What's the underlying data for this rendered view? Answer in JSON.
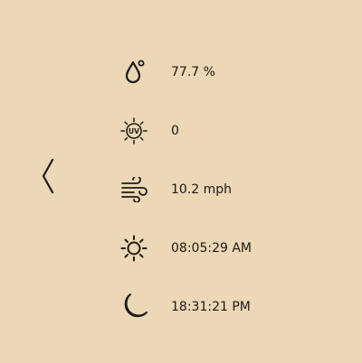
{
  "navigation": {
    "back_icon": "chevron-left-icon"
  },
  "weather": {
    "humidity": {
      "icon": "humidity-droplet-icon",
      "value": "77.7 %"
    },
    "uv_index": {
      "icon": "uv-index-icon",
      "value": "0"
    },
    "wind": {
      "icon": "wind-icon",
      "value": "10.2 mph"
    },
    "sunrise": {
      "icon": "sun-icon",
      "value": "08:05:29 AM"
    },
    "sunset": {
      "icon": "moon-icon",
      "value": "18:31:21 PM"
    }
  },
  "colors": {
    "background": "#ecd7b6",
    "foreground": "#1e1a14"
  }
}
